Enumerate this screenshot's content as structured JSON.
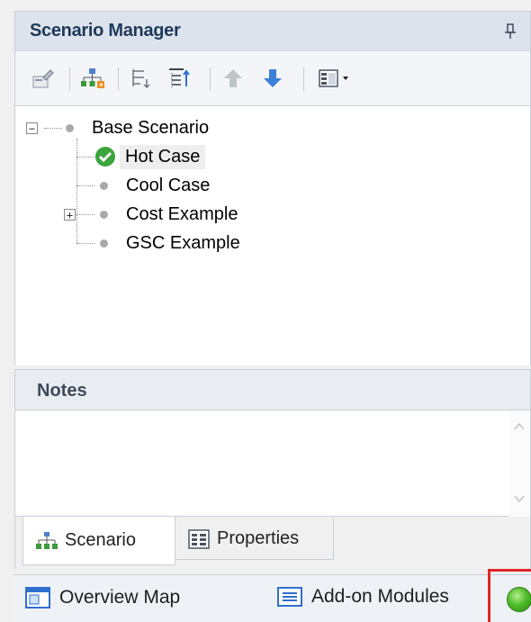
{
  "panel": {
    "title": "Scenario Manager",
    "pin_icon": "pin-icon"
  },
  "toolbar": {
    "buttons": [
      {
        "icon": "edit-scenario-icon"
      },
      {
        "icon": "new-child-scenario-icon"
      },
      {
        "icon": "collapse-tree-icon"
      },
      {
        "icon": "sort-tree-icon"
      },
      {
        "icon": "move-up-arrow-icon"
      },
      {
        "icon": "move-down-arrow-icon"
      },
      {
        "icon": "view-options-dropdown-icon"
      }
    ]
  },
  "tree": {
    "root": {
      "label": "Base Scenario",
      "expanded": true
    },
    "children": [
      {
        "label": "Hot Case",
        "current": true
      },
      {
        "label": "Cool Case"
      },
      {
        "label": "Cost Example",
        "has_children": true
      },
      {
        "label": "GSC Example"
      }
    ],
    "expand_symbol_open": "−",
    "expand_symbol_closed": "+"
  },
  "notes": {
    "title": "Notes",
    "value": ""
  },
  "tabs": [
    {
      "label": "Scenario",
      "active": true
    },
    {
      "label": "Properties",
      "active": false
    }
  ],
  "bottom": {
    "overview_map": "Overview Map",
    "addon_modules": "Add-on Modules"
  },
  "colors": {
    "header_text": "#1e395b",
    "current_scenario_check": "#3aa53a",
    "move_down_arrow": "#3d7fd9",
    "highlight": "#e0262a",
    "status_orb": "#4fbd2a"
  }
}
